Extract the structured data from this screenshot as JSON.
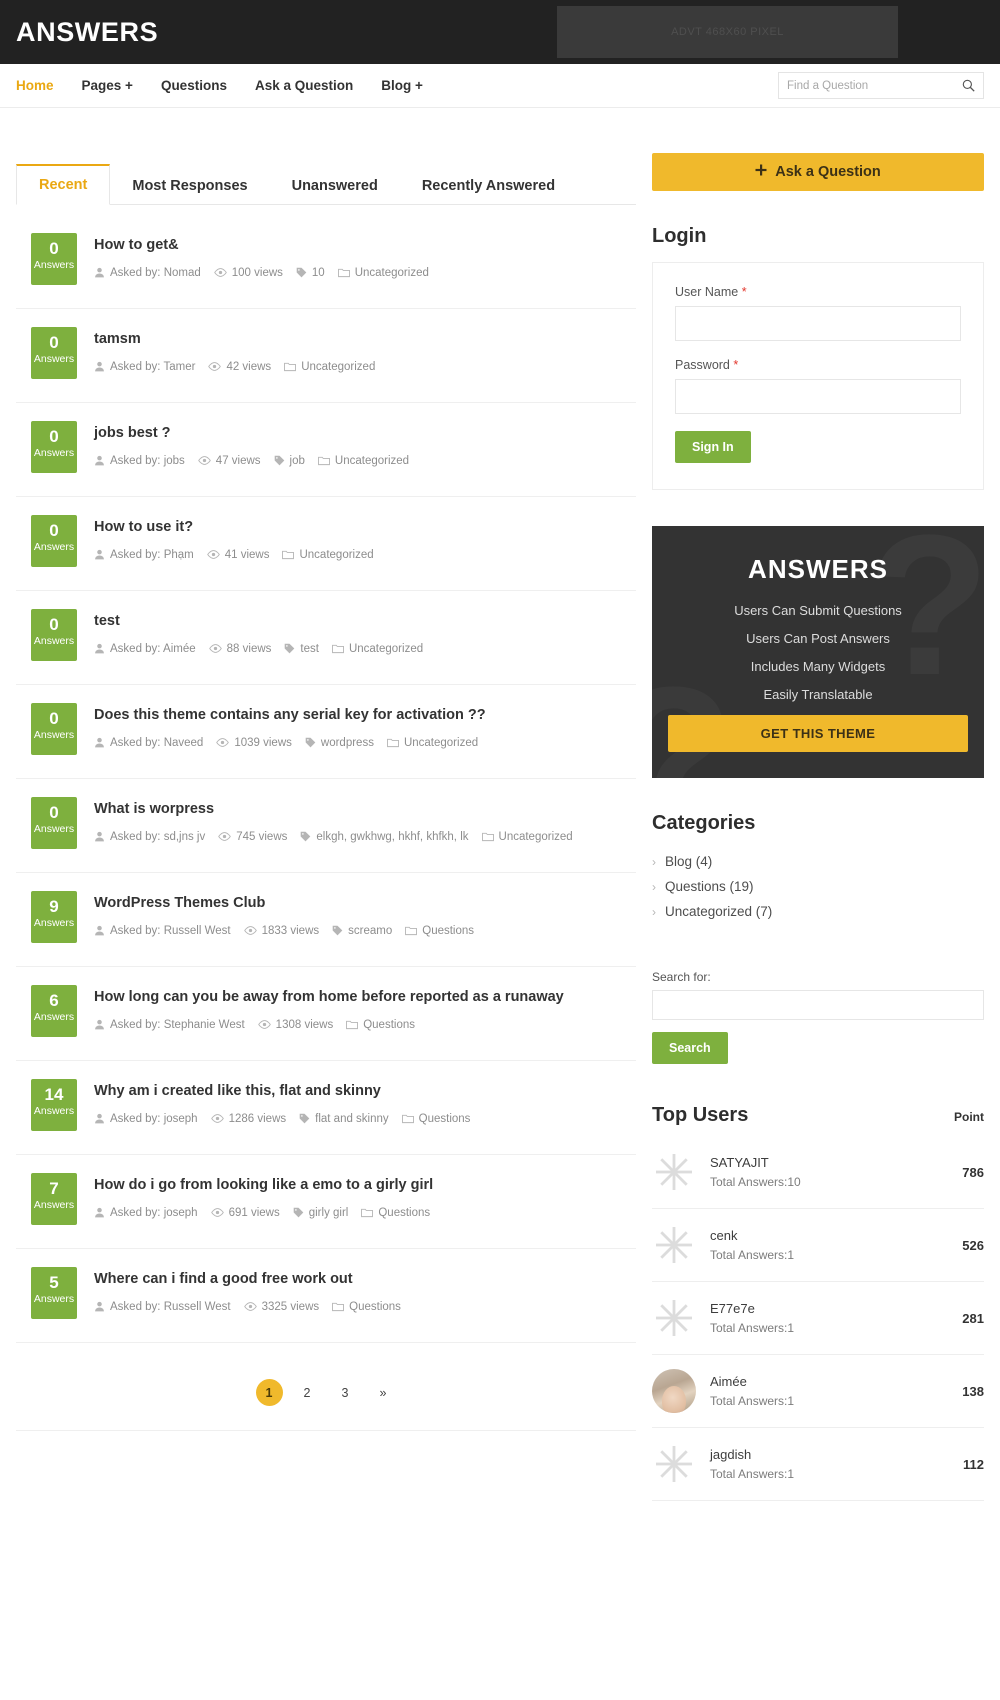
{
  "header": {
    "logo": "ANSWERS",
    "ad_placeholder": "ADVT 468X60 PIXEL"
  },
  "nav": {
    "items": [
      {
        "label": "Home",
        "active": true
      },
      {
        "label": "Pages +",
        "active": false
      },
      {
        "label": "Questions",
        "active": false
      },
      {
        "label": "Ask a Question",
        "active": false
      },
      {
        "label": "Blog +",
        "active": false
      }
    ],
    "search_placeholder": "Find a Question",
    "search_value": "",
    "search_icon": "search-icon"
  },
  "tabs": [
    {
      "label": "Recent",
      "active": true
    },
    {
      "label": "Most Responses",
      "active": false
    },
    {
      "label": "Unanswered",
      "active": false
    },
    {
      "label": "Recently Answered",
      "active": false
    }
  ],
  "questions": [
    {
      "answers": "0",
      "answers_label": "Answers",
      "title": "How to get&",
      "author": "Asked by: Nomad",
      "views": "100 views",
      "tags": "10",
      "category": "Uncategorized"
    },
    {
      "answers": "0",
      "answers_label": "Answers",
      "title": "tamsm",
      "author": "Asked by: Tamer",
      "views": "42 views",
      "tags": "",
      "category": "Uncategorized"
    },
    {
      "answers": "0",
      "answers_label": "Answers",
      "title": "jobs best ?",
      "author": "Asked by: jobs",
      "views": "47 views",
      "tags": "job",
      "category": "Uncategorized"
    },
    {
      "answers": "0",
      "answers_label": "Answers",
      "title": "How to use it?",
      "author": "Asked by: Phạm",
      "views": "41 views",
      "tags": "",
      "category": "Uncategorized"
    },
    {
      "answers": "0",
      "answers_label": "Answers",
      "title": "test",
      "author": "Asked by: Aimée",
      "views": "88 views",
      "tags": "test",
      "category": "Uncategorized"
    },
    {
      "answers": "0",
      "answers_label": "Answers",
      "title": "Does this theme contains any serial key for activation ??",
      "author": "Asked by: Naveed",
      "views": "1039 views",
      "tags": "wordpress",
      "category": "Uncategorized"
    },
    {
      "answers": "0",
      "answers_label": "Answers",
      "title": "What is worpress",
      "author": "Asked by: sd,jns jv",
      "views": "745 views",
      "tags": "elkgh, gwkhwg, hkhf, khfkh, lk",
      "category": "Uncategorized"
    },
    {
      "answers": "9",
      "answers_label": "Answers",
      "title": "WordPress Themes Club",
      "author": "Asked by: Russell West",
      "views": "1833 views",
      "tags": "screamo",
      "category": "Questions"
    },
    {
      "answers": "6",
      "answers_label": "Answers",
      "title": "How long can you be away from home before reported as a runaway",
      "author": "Asked by: Stephanie West",
      "views": "1308 views",
      "tags": "",
      "category": "Questions"
    },
    {
      "answers": "14",
      "answers_label": "Answers",
      "title": "Why am i created like this, flat and skinny",
      "author": "Asked by: joseph",
      "views": "1286 views",
      "tags": "flat and skinny",
      "category": "Questions"
    },
    {
      "answers": "7",
      "answers_label": "Answers",
      "title": "How do i go from looking like a emo to a girly girl",
      "author": "Asked by: joseph",
      "views": "691 views",
      "tags": "girly girl",
      "category": "Questions"
    },
    {
      "answers": "5",
      "answers_label": "Answers",
      "title": "Where can i find a good free work out",
      "author": "Asked by: Russell West",
      "views": "3325 views",
      "tags": "",
      "category": "Questions"
    }
  ],
  "pagination": [
    {
      "label": "1",
      "active": true
    },
    {
      "label": "2",
      "active": false
    },
    {
      "label": "3",
      "active": false
    },
    {
      "label": "»",
      "active": false
    }
  ],
  "sidebar": {
    "ask_button": "Ask a Question",
    "ask_icon": "plus-icon",
    "login": {
      "title": "Login",
      "username_label": "User Name",
      "username_value": "",
      "password_label": "Password",
      "password_value": "",
      "required_mark": "*",
      "submit": "Sign In"
    },
    "promo": {
      "title": "ANSWERS",
      "lines": [
        "Users Can Submit Questions",
        "Users Can Post Answers",
        "Includes Many Widgets",
        "Easily Translatable"
      ],
      "button": "GET THIS THEME",
      "watermark": "?"
    },
    "categories": {
      "title": "Categories",
      "items": [
        {
          "label": "Blog (4)"
        },
        {
          "label": "Questions (19)"
        },
        {
          "label": "Uncategorized (7)"
        }
      ]
    },
    "search_widget": {
      "label": "Search for:",
      "value": "",
      "button": "Search"
    },
    "top_users": {
      "title": "Top Users",
      "point_label": "Point",
      "users": [
        {
          "name": "SATYAJIT",
          "sub": "Total Answers:10",
          "points": "786",
          "avatar": "starburst"
        },
        {
          "name": "cenk",
          "sub": "Total Answers:1",
          "points": "526",
          "avatar": "starburst"
        },
        {
          "name": "E77e7e",
          "sub": "Total Answers:1",
          "points": "281",
          "avatar": "starburst"
        },
        {
          "name": "Aimée",
          "sub": "Total Answers:1",
          "points": "138",
          "avatar": "photo"
        },
        {
          "name": "jagdish",
          "sub": "Total Answers:1",
          "points": "112",
          "avatar": "starburst"
        }
      ]
    }
  },
  "colors": {
    "accent_yellow": "#f0b92c",
    "green": "#7eb03e",
    "dark": "#222222"
  }
}
